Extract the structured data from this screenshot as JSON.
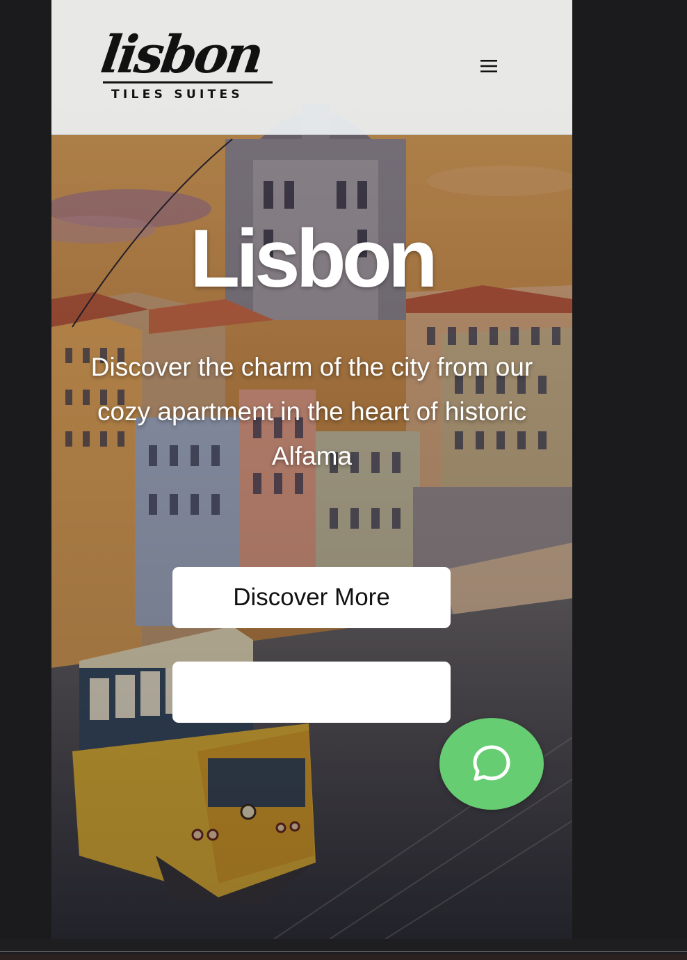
{
  "header": {
    "logo_script": "lisbon",
    "logo_subtitle": "TILES SUITES",
    "menu_icon": "hamburger-menu-icon"
  },
  "hero": {
    "title": "Lisbon",
    "subtitle": "Discover the charm of the city from our cozy apartment in the heart of historic Alfama",
    "primary_button_label": "Discover More",
    "secondary_button_label": ""
  },
  "chat": {
    "icon": "chat-bubble-icon",
    "color": "#66cd72"
  },
  "colors": {
    "page_background": "#1b1b1d",
    "header_background": "#eceff2",
    "button_background": "#ffffff",
    "tram_yellow": "#e9b93c"
  }
}
